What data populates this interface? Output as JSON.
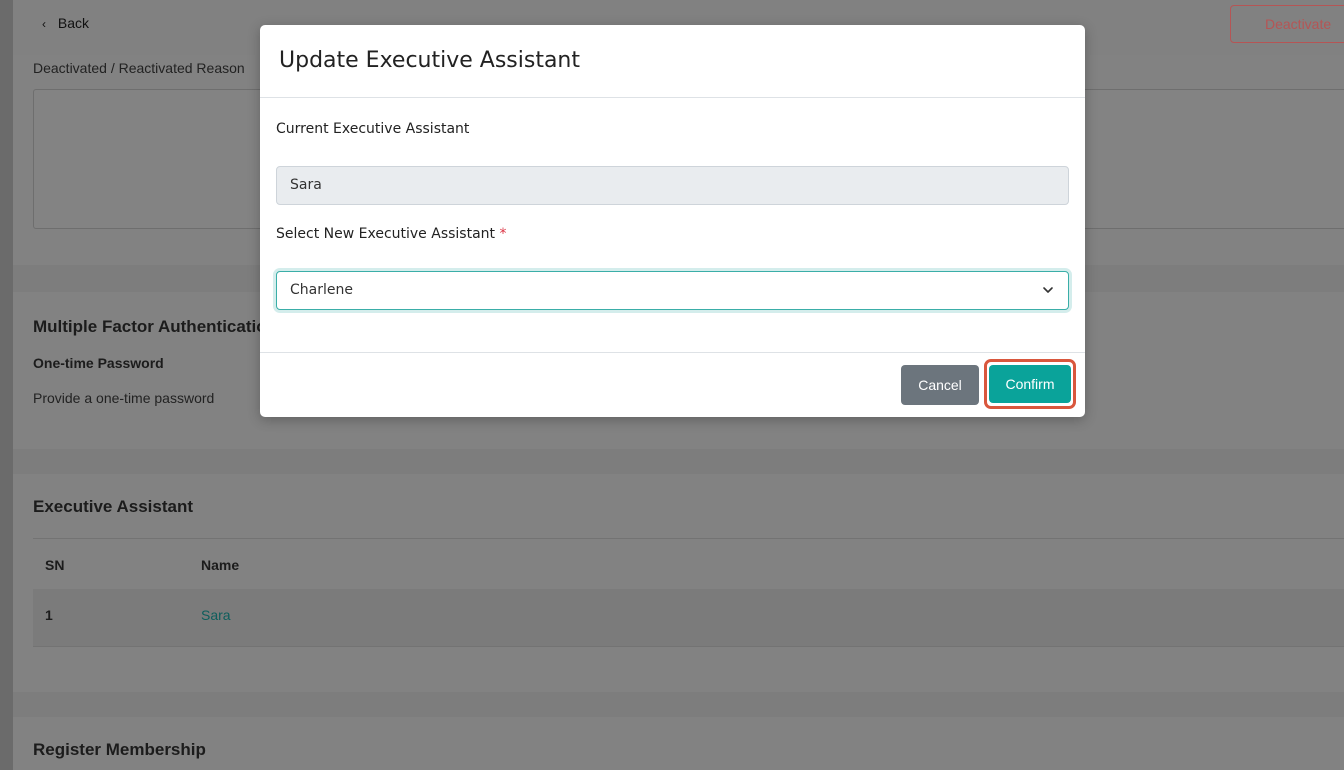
{
  "header": {
    "back_label": "Back",
    "deactivate_label": "Deactivate"
  },
  "reason_card": {
    "label": "Deactivated / Reactivated Reason"
  },
  "mfa_card": {
    "title": "Multiple Factor Authentication",
    "subtitle": "One-time Password",
    "description": "Provide a one-time password"
  },
  "ea_card": {
    "title": "Executive Assistant",
    "columns": [
      "SN",
      "Name"
    ],
    "rows": [
      {
        "sn": "1",
        "name": "Sara"
      }
    ]
  },
  "reg_card": {
    "title": "Register Membership"
  },
  "modal": {
    "title": "Update Executive Assistant",
    "current_label": "Current Executive Assistant",
    "current_value": "Sara",
    "new_label": "Select New Executive Assistant",
    "required_mark": "*",
    "new_value": "Charlene",
    "cancel_label": "Cancel",
    "confirm_label": "Confirm"
  },
  "colors": {
    "accent": "#0aa39a",
    "danger": "#dc3545",
    "highlight": "#d9573d",
    "secondary": "#6c757d"
  }
}
